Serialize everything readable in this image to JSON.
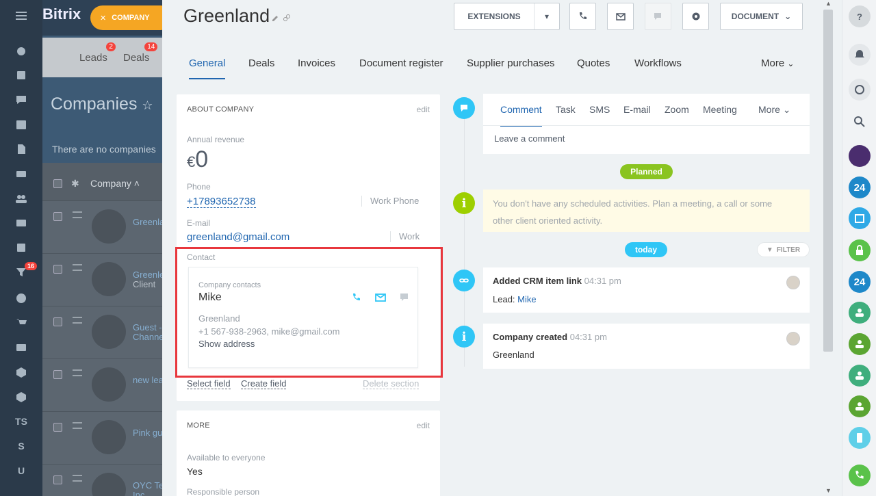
{
  "left_sidebar": {
    "badge_count": "16",
    "labels": [
      "TS",
      "S",
      "U"
    ]
  },
  "background": {
    "logo": "Bitrix",
    "company_chip": "COMPANY",
    "tabs": [
      {
        "label": "Leads",
        "badge": "2"
      },
      {
        "label": "Deals",
        "badge": "14"
      }
    ],
    "page_title": "Companies",
    "empty_text": "There are no companies",
    "column_header": "Company",
    "rows": [
      {
        "name": "Greenla",
        "sub": ""
      },
      {
        "name": "Greenle",
        "sub": "Client"
      },
      {
        "name": "Guest -",
        "sub": "Channe"
      },
      {
        "name": "new lea",
        "sub": ""
      },
      {
        "name": "Pink gu",
        "sub": ""
      },
      {
        "name": "OYC Te",
        "sub": "Inc."
      }
    ]
  },
  "header": {
    "title": "Greenland",
    "extensions_label": "EXTENSIONS",
    "document_label": "DOCUMENT"
  },
  "tabs": [
    {
      "label": "General"
    },
    {
      "label": "Deals"
    },
    {
      "label": "Invoices"
    },
    {
      "label": "Document register"
    },
    {
      "label": "Supplier purchases"
    },
    {
      "label": "Quotes"
    },
    {
      "label": "Workflows"
    },
    {
      "label": "More"
    }
  ],
  "about": {
    "heading": "ABOUT COMPANY",
    "edit": "edit",
    "revenue_label": "Annual revenue",
    "revenue_currency": "€",
    "revenue_value": "0",
    "phone_label": "Phone",
    "phone_value": "+17893652738",
    "phone_type": "Work Phone",
    "email_label": "E-mail",
    "email_value": "greenland@gmail.com",
    "email_type": "Work",
    "contact_label": "Contact",
    "contact": {
      "group": "Company contacts",
      "name": "Mike",
      "company": "Greenland",
      "details": "+1 567-938-2963, mike@gmail.com",
      "address_link": "Show address"
    },
    "select_field": "Select field",
    "create_field": "Create field",
    "delete_section": "Delete section"
  },
  "more": {
    "heading": "MORE",
    "edit": "edit",
    "avail_label": "Available to everyone",
    "avail_value": "Yes",
    "responsible_label": "Responsible person"
  },
  "timeline": {
    "tabs": [
      "Comment",
      "Task",
      "SMS",
      "E-mail",
      "Zoom",
      "Meeting",
      "More"
    ],
    "comment_placeholder": "Leave a comment",
    "planned": "Planned",
    "planned_text": "You don't have any scheduled activities. Plan a meeting, a call or some other client oriented activity.",
    "today": "today",
    "filter": "FILTER",
    "events": [
      {
        "title": "Added CRM item link",
        "time": "04:31 pm",
        "prefix": "Lead: ",
        "link": "Mike"
      },
      {
        "title": "Company created",
        "time": "04:31 pm",
        "body": "Greenland"
      }
    ]
  },
  "colors": {
    "accent": "#2066b0",
    "planned": "#8ac420",
    "today": "#2fc6f6",
    "highlight": "#e8373d"
  }
}
